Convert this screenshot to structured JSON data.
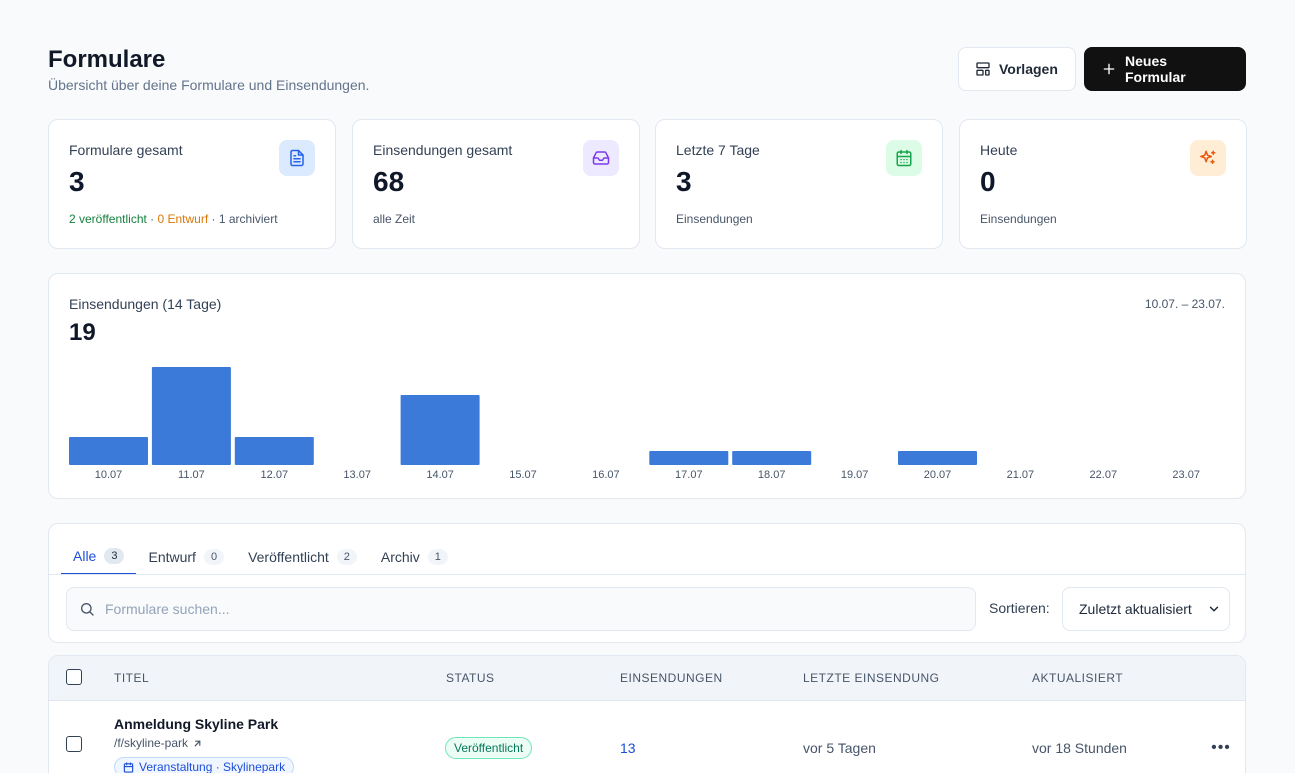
{
  "header": {
    "title": "Formulare",
    "subtitle": "Übersicht über deine Formulare und Einsendungen.",
    "templates_button": "Vorlagen",
    "new_button": "Neues Formular"
  },
  "kpis": [
    {
      "label": "Formulare gesamt",
      "value": "3",
      "icon": "document-icon",
      "color": "#2563eb",
      "bg": "#dbeafe",
      "sub_published": "2 veröffentlicht",
      "sub_sep1": " · ",
      "sub_draft": "0 Entwurf",
      "sub_sep2": " · ",
      "sub_archived": "1 archiviert"
    },
    {
      "label": "Einsendungen gesamt",
      "value": "68",
      "sub": "alle Zeit",
      "icon": "inbox-icon",
      "color": "#7c3aed",
      "bg": "#ede9fe"
    },
    {
      "label": "Letzte 7 Tage",
      "value": "3",
      "sub": "Einsendungen",
      "icon": "calendar-icon",
      "color": "#16a34a",
      "bg": "#dcfce7"
    },
    {
      "label": "Heute",
      "value": "0",
      "sub": "Einsendungen",
      "icon": "sparkles-icon",
      "color": "#ea580c",
      "bg": "#ffedd5"
    }
  ],
  "chart": {
    "title": "Einsendungen (14 Tage)",
    "total": "19",
    "range": "10.07. – 23.07."
  },
  "chart_data": {
    "type": "bar",
    "categories": [
      "10.07",
      "11.07",
      "12.07",
      "13.07",
      "14.07",
      "15.07",
      "16.07",
      "17.07",
      "18.07",
      "19.07",
      "20.07",
      "21.07",
      "22.07",
      "23.07"
    ],
    "values": [
      2,
      7,
      2,
      0,
      5,
      0,
      0,
      1,
      1,
      0,
      1,
      0,
      0,
      0
    ],
    "bar_color": "#3b7ad9",
    "grid": false
  },
  "filters": {
    "tabs": [
      {
        "label": "Alle",
        "count": "3",
        "active": true
      },
      {
        "label": "Entwurf",
        "count": "0"
      },
      {
        "label": "Veröffentlicht",
        "count": "2"
      },
      {
        "label": "Archiv",
        "count": "1"
      }
    ],
    "search_placeholder": "Formulare suchen...",
    "sort_label": "Sortieren:",
    "sort_value": "Zuletzt aktualisiert"
  },
  "table": {
    "columns": [
      "TITEL",
      "STATUS",
      "EINSENDUNGEN",
      "LETZTE EINSENDUNG",
      "AKTUALISIERT"
    ],
    "rows": [
      {
        "title": "Anmeldung Skyline Park",
        "slug": "/f/skyline-park",
        "tag": "Veranstaltung · Skylinepark",
        "status": "Veröffentlicht",
        "submissions": "13",
        "last_submission": "vor 5 Tagen",
        "updated": "vor 18 Stunden"
      }
    ]
  }
}
